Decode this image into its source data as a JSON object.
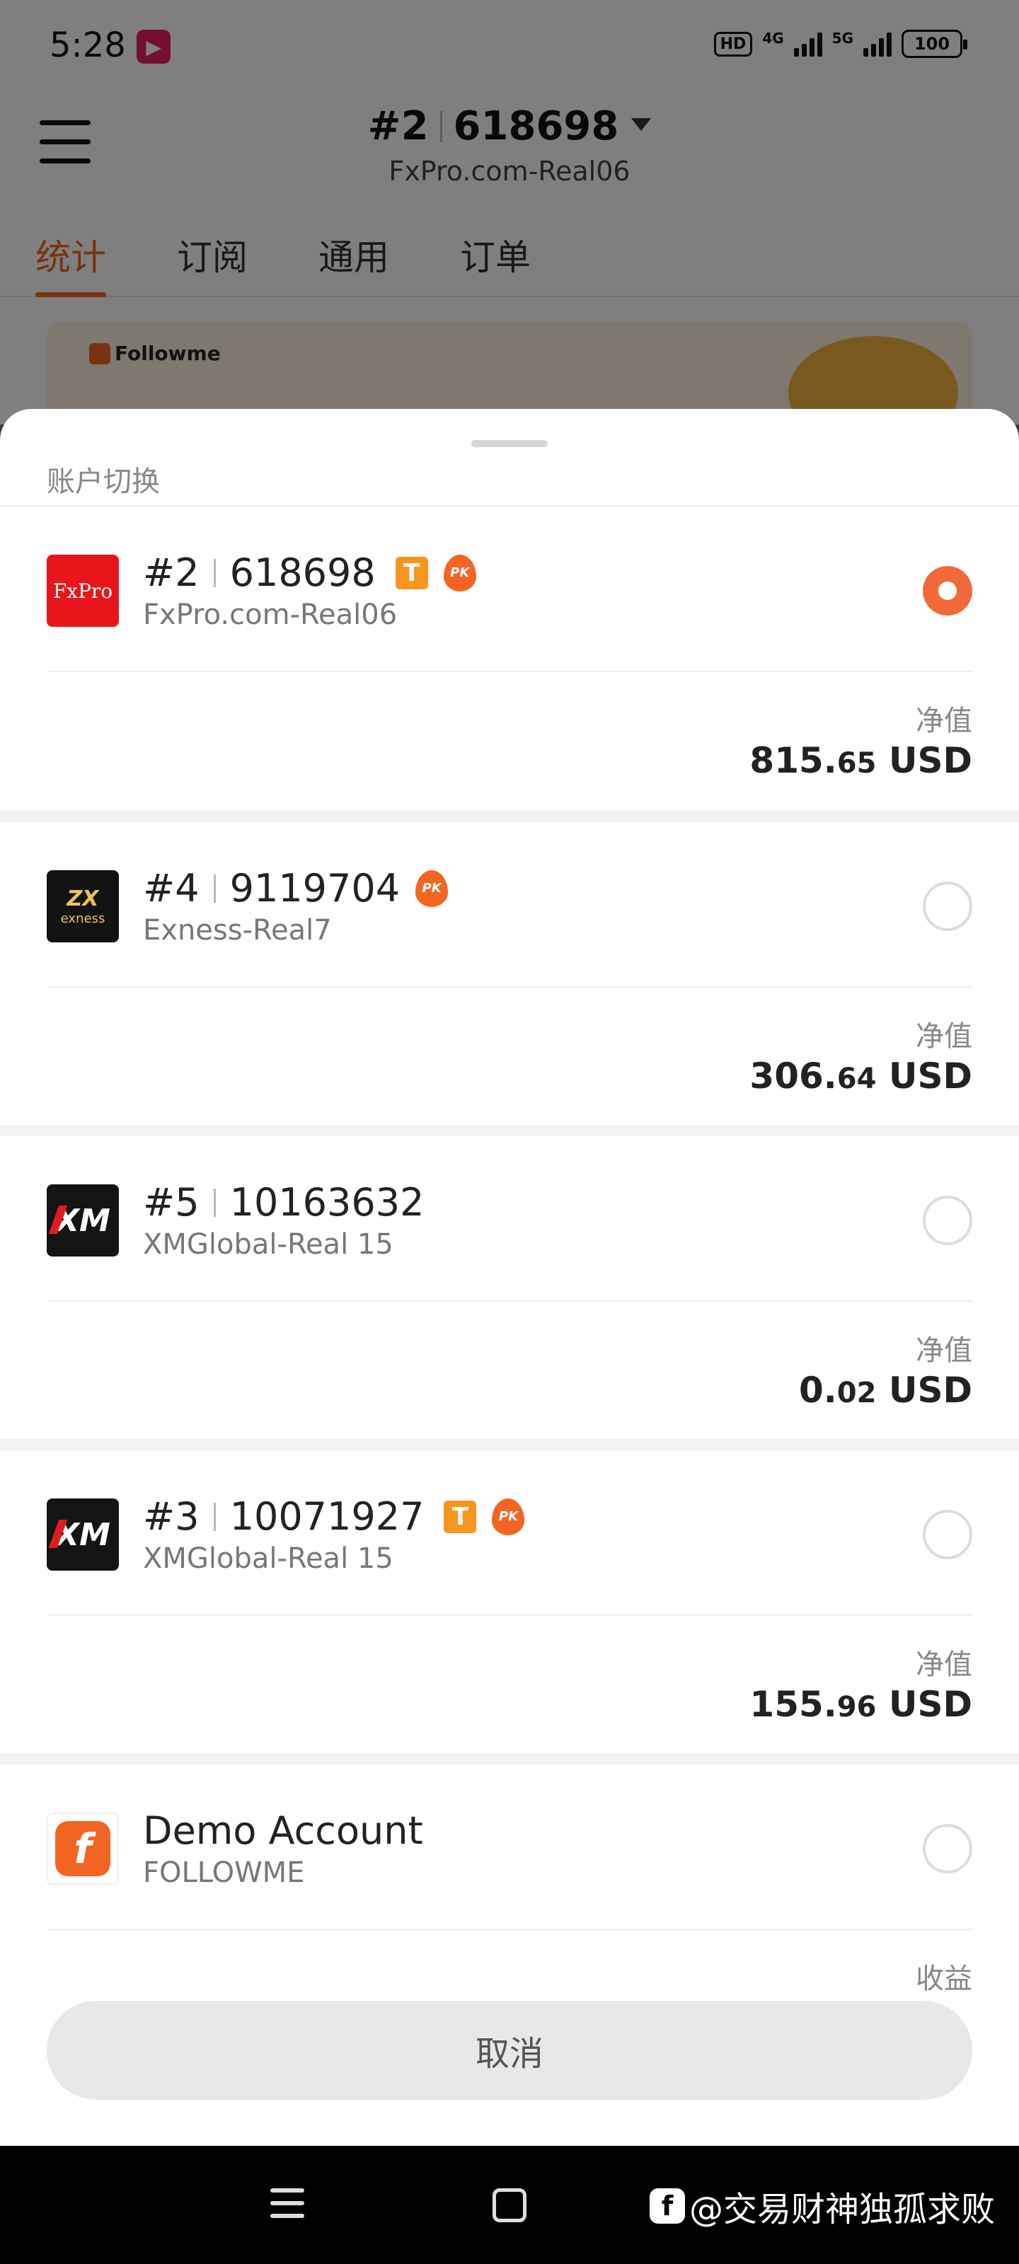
{
  "status_bar": {
    "time": "5:28",
    "network_hd": "HD",
    "net_4g": "4G",
    "net_5g": "5G",
    "battery": "100"
  },
  "header": {
    "account_index": "#2",
    "account_number": "618698",
    "server": "FxPro.com-Real06"
  },
  "tabs": [
    {
      "label": "统计",
      "active": true
    },
    {
      "label": "订阅",
      "active": false
    },
    {
      "label": "通用",
      "active": false
    },
    {
      "label": "订单",
      "active": false
    }
  ],
  "banner": {
    "brand": "Followme"
  },
  "sheet": {
    "title": "账户切换",
    "cancel_label": "取消",
    "accounts": [
      {
        "index": "#2",
        "number": "618698",
        "server": "FxPro.com-Real06",
        "logo": "FxPro",
        "badge_t": "T",
        "badge_pk": "PK",
        "selected": true,
        "value_label": "净值",
        "value_int": "815.",
        "value_dec": "65",
        "currency": " USD"
      },
      {
        "index": "#4",
        "number": "9119704",
        "server": "Exness-Real7",
        "logo": "exness",
        "badge_pk": "PK",
        "selected": false,
        "value_label": "净值",
        "value_int": "306.",
        "value_dec": "64",
        "currency": " USD"
      },
      {
        "index": "#5",
        "number": "10163632",
        "server": "XMGlobal-Real 15",
        "logo": "XM",
        "selected": false,
        "value_label": "净值",
        "value_int": "0.",
        "value_dec": "02",
        "currency": " USD"
      },
      {
        "index": "#3",
        "number": "10071927",
        "server": "XMGlobal-Real 15",
        "logo": "XM",
        "badge_t": "T",
        "badge_pk": "PK",
        "selected": false,
        "value_label": "净值",
        "value_int": "155.",
        "value_dec": "96",
        "currency": " USD"
      },
      {
        "name": "Demo Account",
        "server": "FOLLOWME",
        "logo": "f",
        "selected": false,
        "value_label": "收益"
      }
    ]
  },
  "watermark": {
    "icon": "f",
    "text": "@交易财神独孤求败"
  },
  "colors": {
    "accent": "#f26522",
    "radio_selected": "#f26a3a",
    "badge_t": "#f6961e"
  }
}
